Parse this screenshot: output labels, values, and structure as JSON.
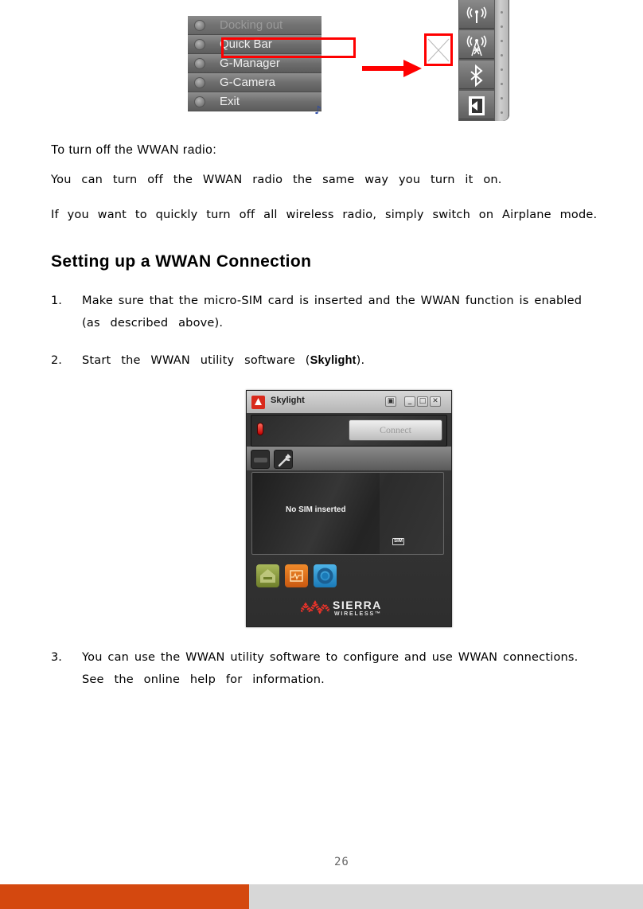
{
  "figure_top": {
    "menu_items": [
      {
        "label": "Docking out",
        "disabled": true
      },
      {
        "label": "Quick Bar",
        "disabled": false
      },
      {
        "label": "G-Manager",
        "disabled": false
      },
      {
        "label": "G-Camera",
        "disabled": false
      },
      {
        "label": "Exit",
        "disabled": false
      }
    ],
    "highlight_color": "#ff0000",
    "quickbar_icons": [
      "wireless-antenna-icon",
      "wwan-tower-icon",
      "bluetooth-icon",
      "exit-door-icon"
    ]
  },
  "content": {
    "subheading": "To turn off the WWAN radio:",
    "paragraph_1": "You can turn off the WWAN radio the same way you turn it on.",
    "paragraph_2": "If you want to quickly turn off all wireless radio, simply switch on Airplane mode.",
    "section_title": "Setting up a WWAN Connection",
    "steps": [
      {
        "number": "1.",
        "lines": [
          "Make sure that the micro-SIM card is inserted and the WWAN function is enabled",
          "(as described above)."
        ]
      },
      {
        "number": "2.",
        "prefix": "Start the WWAN utility software (",
        "bold": "Skylight",
        "suffix": ")."
      },
      {
        "number": "3.",
        "lines": [
          "You can use the WWAN utility software to configure and use WWAN connections.",
          "See the online help for information."
        ]
      }
    ]
  },
  "skylight": {
    "title": "Skylight",
    "window_buttons": {
      "compact": "▣",
      "minimize": "_",
      "maximize": "□",
      "close": "✕"
    },
    "connect_label": "Connect",
    "status": "No SIM inserted",
    "sim_badge": "SIM",
    "brand_line_1": "SIERRA",
    "brand_line_2": "WIRELESS™"
  },
  "footer": {
    "page_number": "26",
    "accent_color": "#d4480f",
    "bar_gray": "#d7d7d7"
  }
}
